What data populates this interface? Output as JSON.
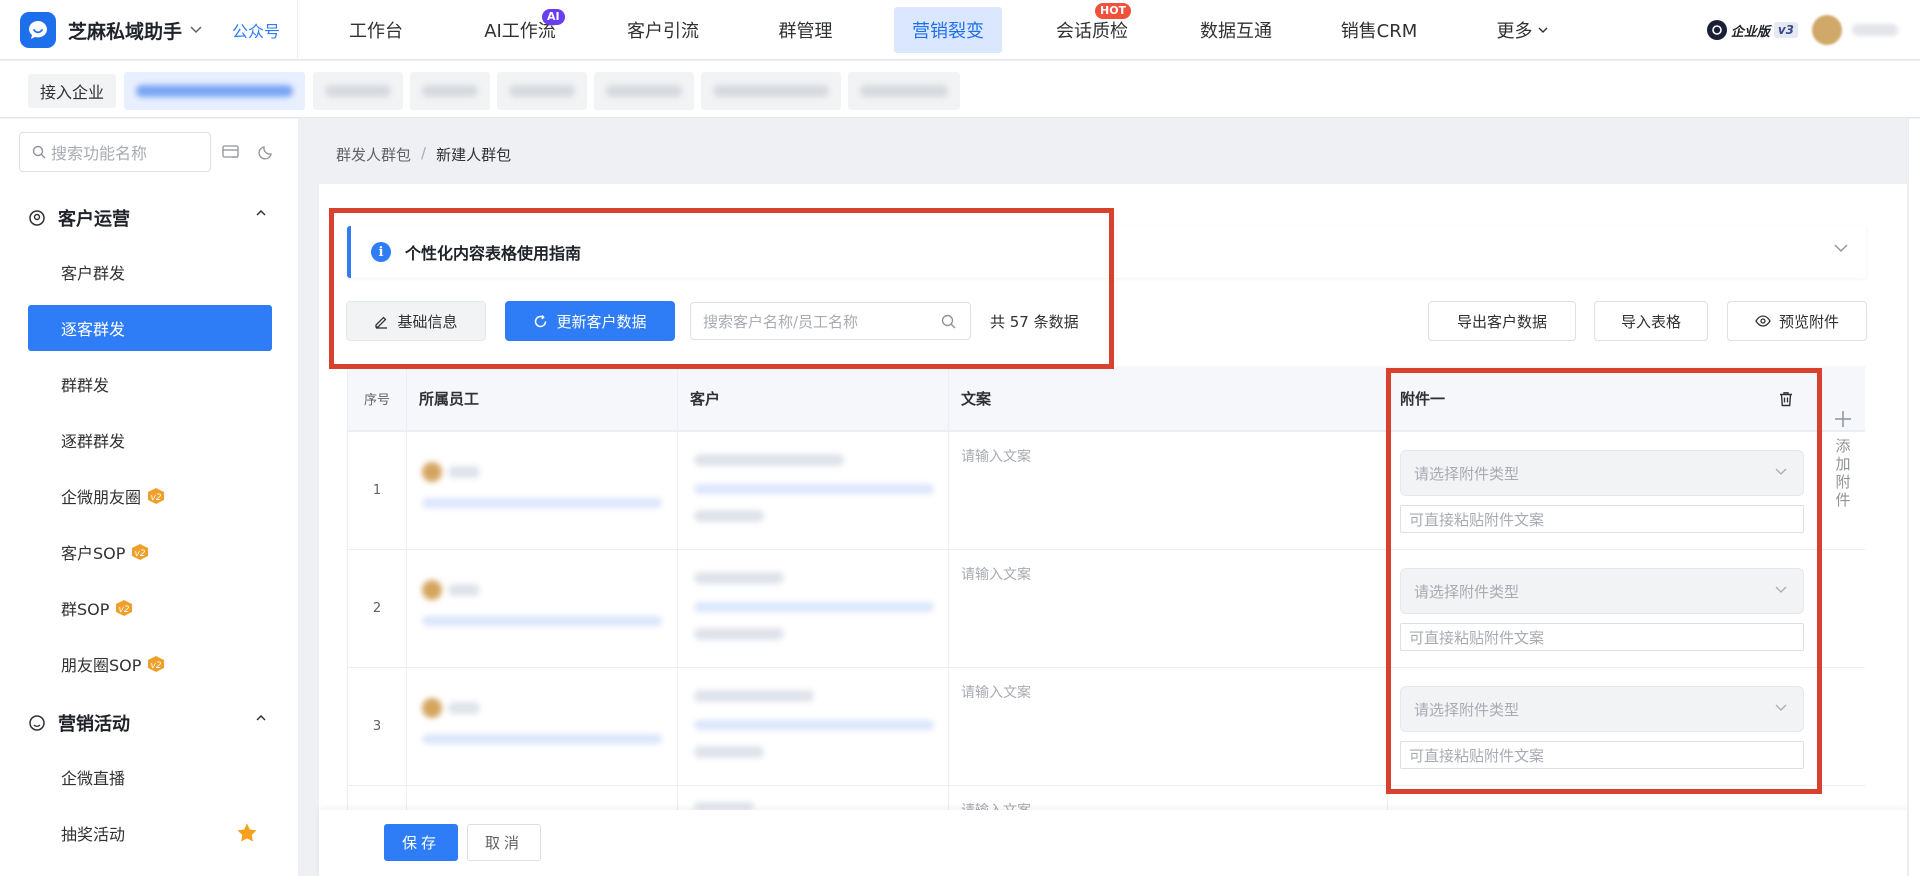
{
  "app": {
    "name": "芝麻私域助手",
    "gzh": "公众号"
  },
  "nav": [
    {
      "label": "工作台"
    },
    {
      "label": "AI工作流",
      "badge": "AI"
    },
    {
      "label": "客户引流"
    },
    {
      "label": "群管理"
    },
    {
      "label": "营销裂变",
      "active": true
    },
    {
      "label": "会话质检",
      "badge": "HOT"
    },
    {
      "label": "数据互通"
    },
    {
      "label": "销售CRM"
    },
    {
      "label": "更多"
    }
  ],
  "topright": {
    "edition": "企业版",
    "version": "v3"
  },
  "subbar": {
    "enterprise_button": "接入企业"
  },
  "sidebar": {
    "search_placeholder": "搜索功能名称",
    "sections": [
      {
        "title": "客户运营",
        "items": [
          "客户群发",
          "逐客群发",
          "群群发",
          "逐群群发",
          "企微朋友圈",
          "客户SOP",
          "群SOP",
          "朋友圈SOP"
        ]
      },
      {
        "title": "营销活动",
        "items": [
          "企微直播",
          "抽奖活动"
        ]
      }
    ],
    "active_item": "逐客群发",
    "v2_badge": "v2"
  },
  "breadcrumb": {
    "parent": "群发人群包",
    "sep": "/",
    "current": "新建人群包"
  },
  "guide": {
    "title": "个性化内容表格使用指南",
    "icon": "i"
  },
  "toolbar": {
    "basic_info": "基础信息",
    "update_data": "更新客户数据",
    "search_placeholder": "搜索客户名称/员工名称",
    "count_text": "共 57 条数据",
    "export": "导出客户数据",
    "import": "导入表格",
    "preview": "预览附件"
  },
  "table": {
    "columns": [
      "序号",
      "所属员工",
      "客户",
      "文案",
      "附件一"
    ],
    "rows": [
      {
        "index": "1",
        "copy_placeholder": "请输入文案",
        "attach_type_placeholder": "请选择附件类型",
        "attach_paste_placeholder": "可直接粘贴附件文案"
      },
      {
        "index": "2",
        "copy_placeholder": "请输入文案",
        "attach_type_placeholder": "请选择附件类型",
        "attach_paste_placeholder": "可直接粘贴附件文案"
      },
      {
        "index": "3",
        "copy_placeholder": "请输入文案",
        "attach_type_placeholder": "请选择附件类型",
        "attach_paste_placeholder": "可直接粘贴附件文案"
      },
      {
        "index": "",
        "copy_placeholder": "请输入文案"
      }
    ],
    "add_attachment": "添加附件"
  },
  "footer": {
    "save": "保存",
    "cancel": "取消"
  },
  "colors": {
    "primary": "#2f7df6",
    "annotation": "#d9412f",
    "ai_badge": "#6a3df0",
    "hot_badge": "#f0503c"
  }
}
